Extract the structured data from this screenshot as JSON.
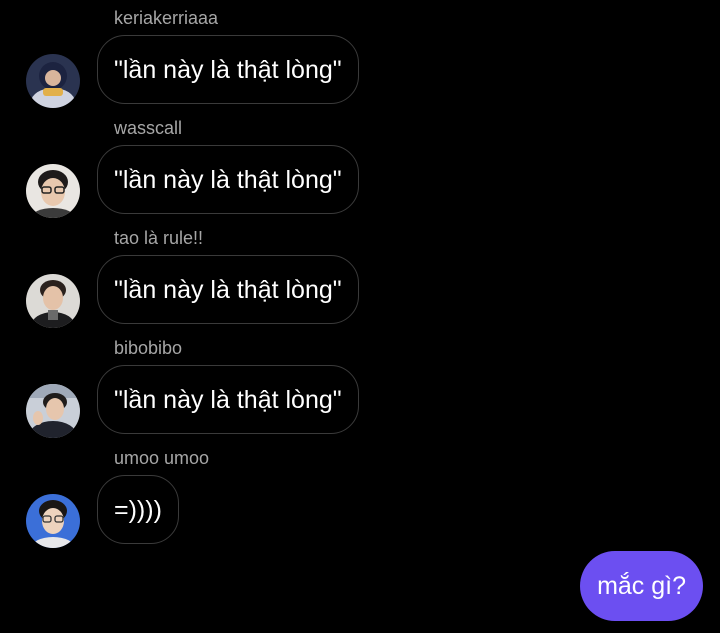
{
  "colors": {
    "background": "#000000",
    "sender_text": "#a6a6a6",
    "bubble_border": "#3a3a3a",
    "own_bubble": "#6c4ff1"
  },
  "messages": [
    {
      "sender": "keriakerriaaa",
      "text": "\"lần này là thật lòng\"",
      "avatar": "avatar-keriakerriaaa"
    },
    {
      "sender": "wasscall",
      "text": "\"lần này là thật lòng\"",
      "avatar": "avatar-wasscall"
    },
    {
      "sender": "tao là rule!!",
      "text": "\"lần này là thật lòng\"",
      "avatar": "avatar-tao-la-rule"
    },
    {
      "sender": "bibobibo",
      "text": "\"lần này là thật lòng\"",
      "avatar": "avatar-bibobibo"
    },
    {
      "sender": "umoo umoo",
      "text": "=))))",
      "avatar": "avatar-umoo-umoo"
    }
  ],
  "own_message": {
    "text": "mắc gì?"
  }
}
